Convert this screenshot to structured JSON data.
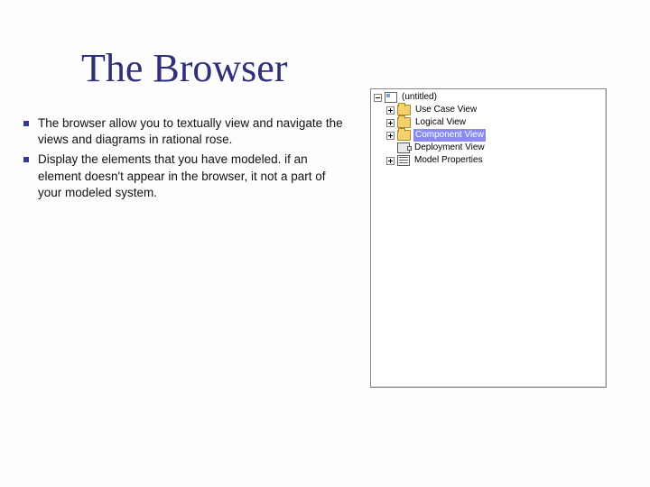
{
  "title": "The Browser",
  "bullets": [
    "The browser allow you to textually view and navigate the views and diagrams in rational rose.",
    "Display the elements that you have modeled. if an element doesn't appear in the browser, it not a part of your modeled system."
  ],
  "tree": {
    "root": {
      "label": "(untitled)",
      "expander": "minus",
      "iconType": "box",
      "depth": 0,
      "selected": false
    },
    "children": [
      {
        "label": "Use Case View",
        "expander": "plus",
        "iconType": "folder",
        "depth": 1,
        "selected": false
      },
      {
        "label": "Logical View",
        "expander": "plus",
        "iconType": "folder",
        "depth": 1,
        "selected": false
      },
      {
        "label": "Component View",
        "expander": "plus",
        "iconType": "folder",
        "depth": 1,
        "selected": true
      },
      {
        "label": "Deployment View",
        "expander": "",
        "iconType": "deploy",
        "depth": 1,
        "selected": false
      },
      {
        "label": "Model Properties",
        "expander": "plus",
        "iconType": "props",
        "depth": 1,
        "selected": false
      }
    ]
  }
}
